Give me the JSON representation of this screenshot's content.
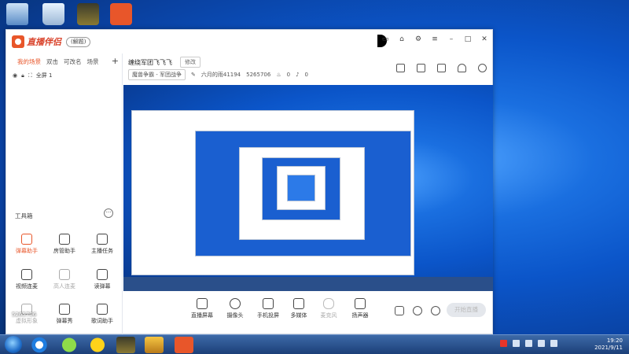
{
  "app": {
    "name": "直播伴侣",
    "edition": "(解题)",
    "window_controls": [
      "feedback-icon",
      "skin-icon",
      "settings-icon",
      "menu-icon",
      "minimize-icon",
      "maximize-icon",
      "close-icon"
    ]
  },
  "sidebar": {
    "tabs": [
      {
        "label": "我的场景",
        "active": true
      },
      {
        "label": "双击",
        "active": false
      },
      {
        "label": "可改名",
        "active": false
      },
      {
        "label": "场景",
        "active": false
      }
    ],
    "add_label": "+",
    "scene_item": "全屏 1"
  },
  "toolbox": {
    "title": "工具箱",
    "more": "···",
    "tools": [
      {
        "label": "弹幕助手",
        "icon": "danmaku-icon",
        "hot": true
      },
      {
        "label": "房管助手",
        "icon": "moderator-icon",
        "hot": false
      },
      {
        "label": "主播任务",
        "icon": "task-icon",
        "hot": false
      },
      {
        "label": "视频连麦",
        "icon": "video-link-icon",
        "hot": false
      },
      {
        "label": "高人连麦",
        "icon": "download-icon",
        "hot": false
      },
      {
        "label": "读弹幕",
        "icon": "read-danmaku-icon",
        "hot": false
      },
      {
        "label": "虚拟形象",
        "icon": "avatar-icon",
        "hot": false
      },
      {
        "label": "弹幕秀",
        "icon": "danmaku-show-icon",
        "hot": false
      },
      {
        "label": "歌词助手",
        "icon": "lyrics-icon",
        "hot": false
      }
    ]
  },
  "room": {
    "title": "缠绕军团飞飞飞",
    "edit_label": "修改",
    "category": "魔兽争霸 - 军团战争",
    "id_text": "六月的雨41194",
    "followers": "5265706",
    "likes": "0",
    "viewers": "0"
  },
  "controls": [
    {
      "label": "直播屏幕",
      "icon": "screen-capture-icon",
      "dim": false
    },
    {
      "label": "摄像头",
      "icon": "camera-icon",
      "dim": false
    },
    {
      "label": "手机投屏",
      "icon": "phone-cast-icon",
      "dim": false
    },
    {
      "label": "多媒体",
      "icon": "media-icon",
      "dim": false
    },
    {
      "label": "麦克风",
      "icon": "microphone-icon",
      "dim": true
    },
    {
      "label": "扬声器",
      "icon": "speaker-icon",
      "dim": false
    }
  ],
  "live_button": "开始直播",
  "taskbar": {
    "time": "19:20",
    "date": "2021/9/11"
  },
  "overlay_label": "5265706"
}
